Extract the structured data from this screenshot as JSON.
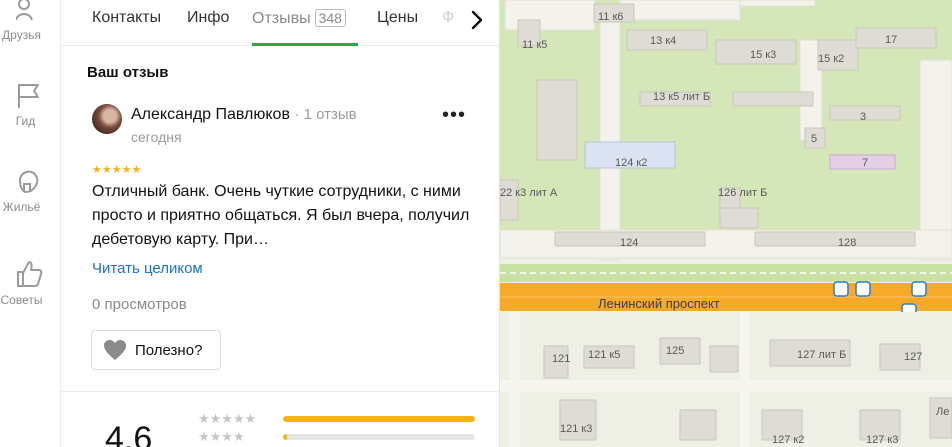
{
  "sidebar": {
    "items": [
      {
        "label": "Друзья",
        "icon": "friends-icon"
      },
      {
        "label": "Гид",
        "icon": "flag-icon"
      },
      {
        "label": "Жильё",
        "icon": "house-icon"
      },
      {
        "label": "Советы",
        "icon": "thumb-up-icon"
      }
    ]
  },
  "tabs": {
    "items": [
      {
        "label": "Контакты"
      },
      {
        "label": "Инфо"
      },
      {
        "label": "Отзывы",
        "count": "348"
      },
      {
        "label": "Цены"
      },
      {
        "label": "Ф"
      }
    ],
    "active": "Отзывы"
  },
  "review": {
    "section_title": "Ваш отзыв",
    "author": "Александр Павлюков",
    "author_count": "· 1 отзыв",
    "date": "сегодня",
    "more": "•••",
    "stars": "★★★★★",
    "rating": 5,
    "text": "Отличный банк. Очень чуткие сотрудники, с ними просто и приятно общаться. Я был вчера, получил дебетовую карту. При…",
    "read_more": "Читать целиком",
    "views": "0 просмотров",
    "useful_label": "Полезно?"
  },
  "summary": {
    "rating": "4,6",
    "rows": [
      {
        "stars": "★★★★★",
        "fraction": 1.0
      },
      {
        "stars": "★★★★",
        "fraction": 0.02
      }
    ]
  },
  "map": {
    "street": "Ленинский проспект",
    "labels": [
      "11 к6",
      "11 к5",
      "13 к4",
      "15 к3",
      "15 к2",
      "17",
      "13 к5 лит Б",
      "3",
      "5",
      "124 к2",
      "7",
      "22 к3 лит А",
      "126 лит Б",
      "124",
      "128",
      "121",
      "121 к5",
      "125",
      "127 лит Б",
      "127",
      "121 к3",
      "127 к2",
      "127 к3",
      "Ле"
    ],
    "colors": {
      "land": "#eef0e6",
      "green": "#d5e7b8",
      "avenue": "#f7a928",
      "building": "#d8d6cf",
      "accent": "#2ea844",
      "link": "#1a73c8",
      "star": "#f5b319"
    }
  }
}
